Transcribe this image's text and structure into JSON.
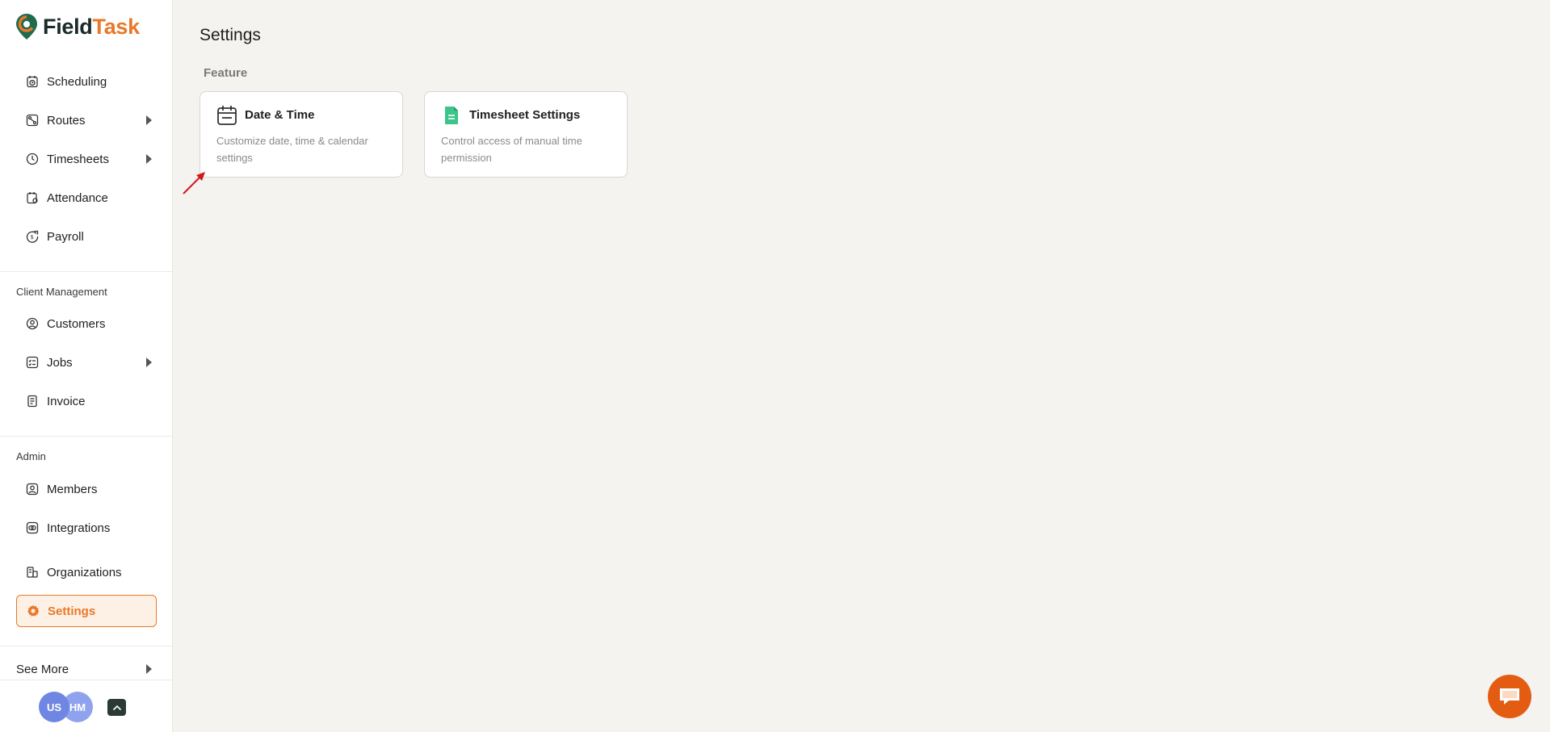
{
  "brand": {
    "name_part1": "Field",
    "name_part2": "Task",
    "accent": "#e9782a"
  },
  "sidebar": {
    "main_items": [
      {
        "label": "Scheduling",
        "icon": "calendar-clock-icon",
        "has_submenu": false
      },
      {
        "label": "Routes",
        "icon": "route-icon",
        "has_submenu": true
      },
      {
        "label": "Timesheets",
        "icon": "clock-icon",
        "has_submenu": true
      },
      {
        "label": "Attendance",
        "icon": "attendance-icon",
        "has_submenu": false
      },
      {
        "label": "Payroll",
        "icon": "payroll-icon",
        "has_submenu": false
      }
    ],
    "client_section": {
      "title": "Client Management",
      "items": [
        {
          "label": "Customers",
          "icon": "customer-icon",
          "has_submenu": false
        },
        {
          "label": "Jobs",
          "icon": "jobs-icon",
          "has_submenu": true
        },
        {
          "label": "Invoice",
          "icon": "invoice-icon",
          "has_submenu": false
        }
      ]
    },
    "admin_section": {
      "title": "Admin",
      "items": [
        {
          "label": "Members",
          "icon": "member-icon",
          "has_submenu": false
        },
        {
          "label": "Integrations",
          "icon": "integrations-icon",
          "has_submenu": false
        },
        {
          "label": "Organizations",
          "icon": "organization-icon",
          "has_submenu": false
        },
        {
          "label": "Settings",
          "icon": "gear-icon",
          "has_submenu": false,
          "active": true
        }
      ]
    },
    "see_more": "See More",
    "avatars": [
      "US",
      "HM"
    ]
  },
  "main": {
    "title": "Settings",
    "section_label": "Feature",
    "cards": [
      {
        "title": "Date & Time",
        "description": "Customize date, time & calendar settings",
        "icon": "calendar-icon"
      },
      {
        "title": "Timesheet Settings",
        "description": "Control access of manual time permission",
        "icon": "timesheet-doc-icon"
      }
    ]
  }
}
